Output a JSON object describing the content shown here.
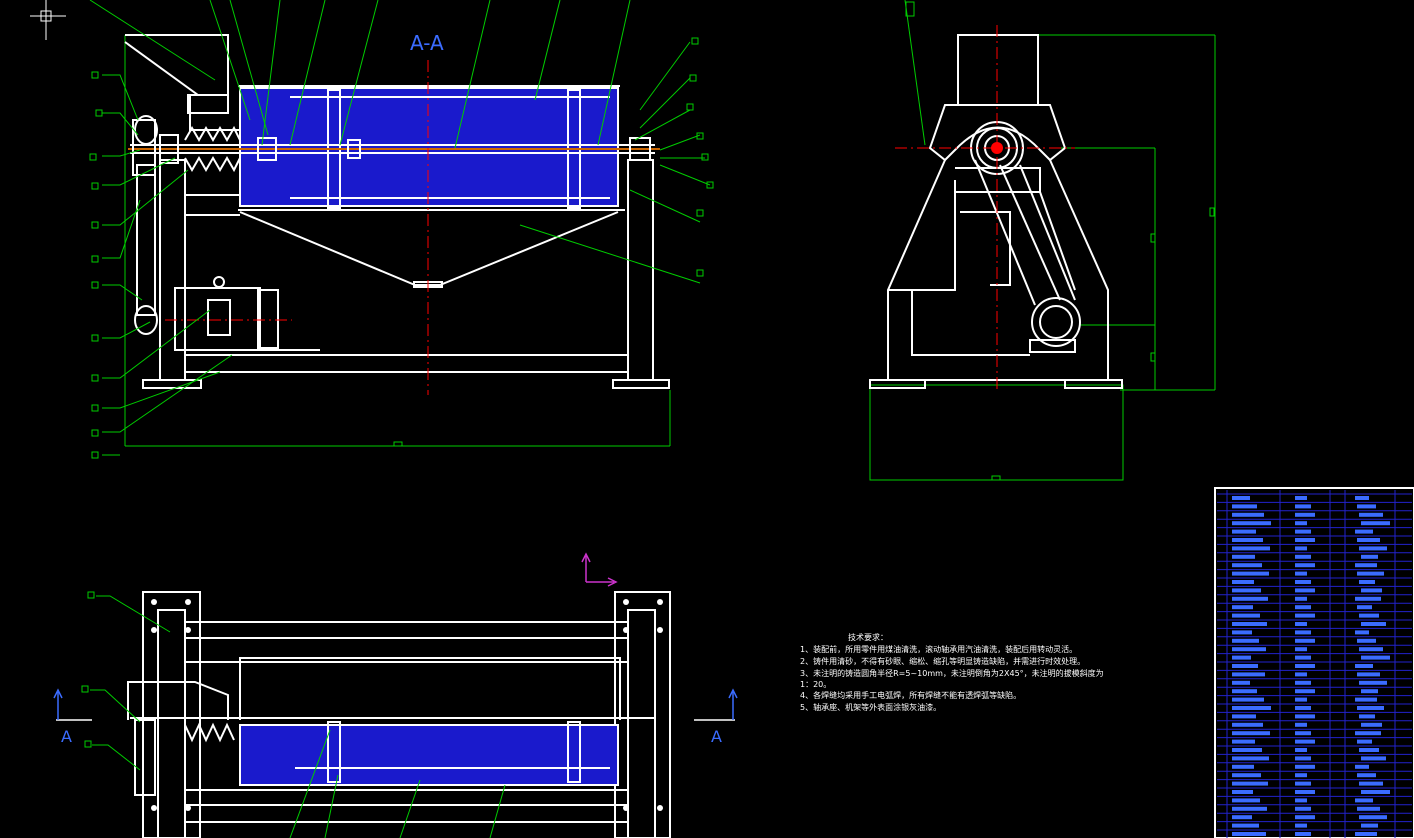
{
  "section_label": "A-A",
  "view_marker_left": "A",
  "view_marker_right": "A",
  "notes": {
    "heading": "技术要求：",
    "lines": [
      "1、装配前，所用零件用煤油清洗，滚动轴承用汽油清洗，装配后用转动灵活。",
      "2、铸件用清砂，不得有砂眼、缩松、缩孔等明显铸造缺陷，并需进行时效处理。",
      "3、未注明的铸造圆角半径R=5~10mm，未注明倒角为2X45°，未注明的拔模斜度为",
      "1：20。",
      "4、各焊缝均采用手工电弧焊，所有焊缝不能有透焊弧等缺陷。",
      "5、轴承座、机架等外表面涂银灰油漆。"
    ]
  },
  "colors": {
    "background": "#000000",
    "outline": "#ffffff",
    "leader": "#00ff00",
    "center_line": "#ff0000",
    "hatch_fill": "#1a1acc",
    "section_title": "#3b6cff",
    "axis_marker": "#cc33cc",
    "bom_border": "#2222cc"
  },
  "icons": {
    "cursor": "crosshair-cursor-icon",
    "ucs": "ucs-axis-icon"
  }
}
